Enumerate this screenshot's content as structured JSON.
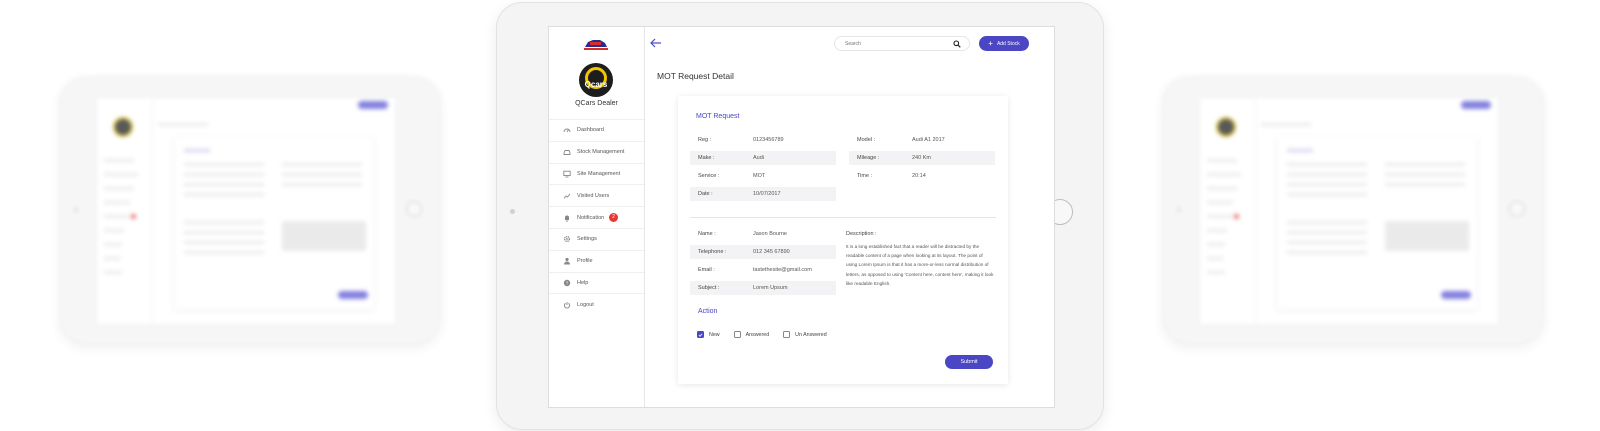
{
  "sidebar": {
    "dealer_name": "QCars Dealer",
    "avatar_text": "Qcars",
    "items": [
      {
        "label": "Dashboard",
        "icon": "dashboard-icon"
      },
      {
        "label": "Stock Management",
        "icon": "car-icon"
      },
      {
        "label": "Site Management",
        "icon": "monitor-icon"
      },
      {
        "label": "Visited Users",
        "icon": "chart-line-icon"
      },
      {
        "label": "Notification",
        "icon": "bell-icon",
        "badge": "2"
      },
      {
        "label": "Settings",
        "icon": "gear-icon"
      },
      {
        "label": "Profile",
        "icon": "user-icon"
      },
      {
        "label": "Help",
        "icon": "help-icon"
      },
      {
        "label": "Logout",
        "icon": "power-icon"
      }
    ]
  },
  "header": {
    "search_placeholder": "Search",
    "add_stock_label": "Add Stock"
  },
  "page_title": "MOT Request Detail",
  "mot": {
    "section_title": "MOT Request",
    "left_fields": [
      {
        "label": "Reg :",
        "value": "0123456789"
      },
      {
        "label": "Make :",
        "value": "Audi"
      },
      {
        "label": "Service :",
        "value": "MOT"
      },
      {
        "label": "Date :",
        "value": "10/07/2017"
      }
    ],
    "right_fields": [
      {
        "label": "Model :",
        "value": "Audi A1 2017"
      },
      {
        "label": "Mileage :",
        "value": "240 Km"
      },
      {
        "label": "Time :",
        "value": "20:14"
      }
    ]
  },
  "contact": {
    "fields": [
      {
        "label": "Name :",
        "value": "Jason Bourne"
      },
      {
        "label": "Telephone :",
        "value": "012 345 67890"
      },
      {
        "label": "Email :",
        "value": "tastethesite@gmail.com"
      },
      {
        "label": "Subject :",
        "value": "Lorem Upsum"
      }
    ],
    "description_label": "Description :",
    "description": "It is a long established fact that a reader will be distracted by the readable content of a page when looking at its layout. The point of using Lorem Ipsum is that it has a more-or-less normal distribution of letters, as opposed to using 'Content here, content here', making it look like readable English."
  },
  "action": {
    "title": "Action",
    "options": [
      {
        "label": "New",
        "checked": true
      },
      {
        "label": "Answered",
        "checked": false
      },
      {
        "label": "Un Answered",
        "checked": false
      }
    ],
    "submit_label": "Submit"
  },
  "colors": {
    "accent": "#4a46c4",
    "badge": "#e53935",
    "logo_ring": "#f2c500"
  }
}
